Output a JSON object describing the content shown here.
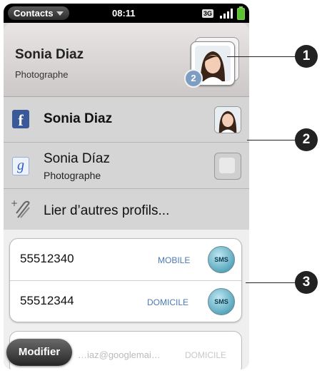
{
  "status_bar": {
    "app_menu_label": "Contacts",
    "time": "08:11",
    "network": "3G"
  },
  "contact": {
    "name": "Sonia Diaz",
    "title": "Photographe",
    "linked_profile_count": "2"
  },
  "profiles": [
    {
      "source": "facebook",
      "icon_letter": "f",
      "name": "Sonia Diaz"
    },
    {
      "source": "google",
      "icon_letter": "g",
      "name": "Sonia Díaz",
      "subtitle": "Photographe"
    }
  ],
  "link_profiles_label": "Lier d’autres profils...",
  "phone_numbers": [
    {
      "number": "55512340",
      "type": "MOBILE",
      "action": "SMS"
    },
    {
      "number": "55512344",
      "type": "DOMICILE",
      "action": "SMS"
    }
  ],
  "email": {
    "value": "…iaz@googlemai…",
    "type": "DOMICILE"
  },
  "edit_button_label": "Modifier",
  "callouts": [
    "1",
    "2",
    "3"
  ],
  "colors": {
    "facebook": "#3b5998",
    "label_blue": "#4a7ab8",
    "battery": "#5cc235"
  }
}
